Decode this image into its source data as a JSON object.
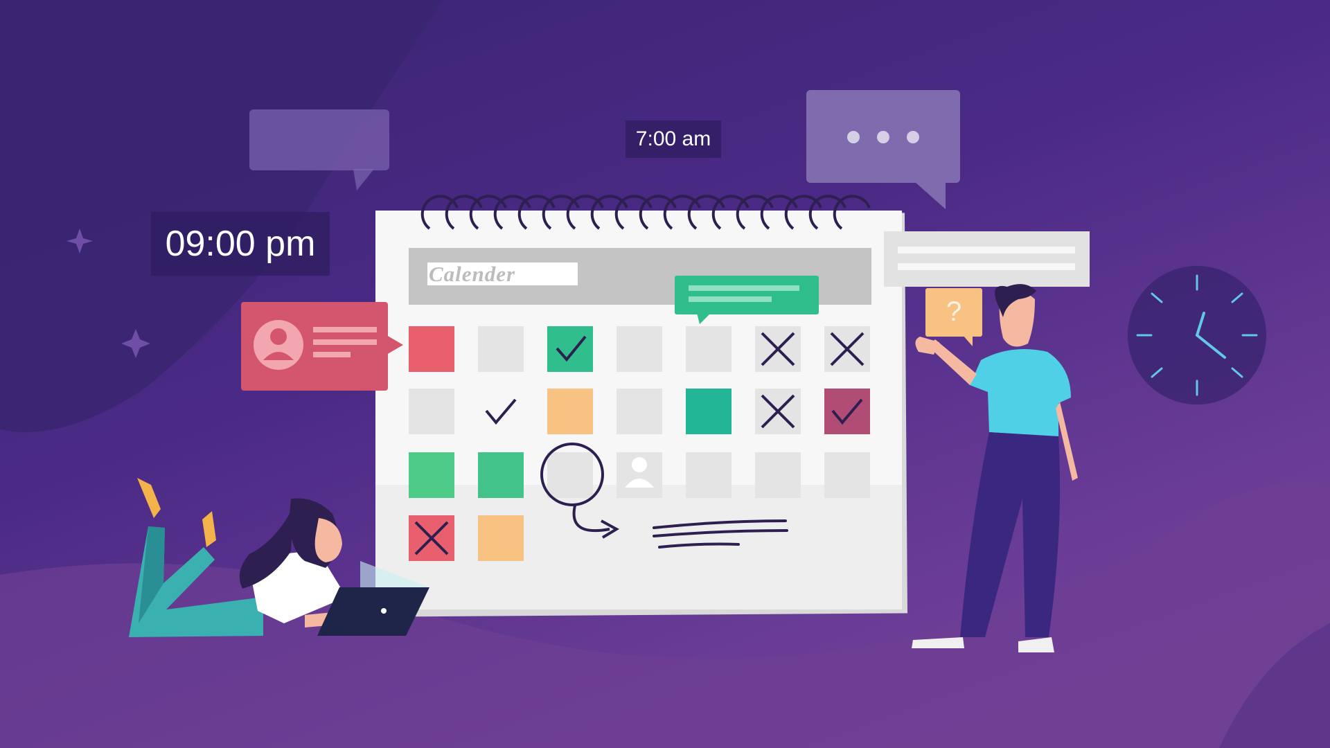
{
  "scene": {
    "time_large": "09:00 pm",
    "time_small": "7:00 am",
    "calendar_title": "Calender",
    "help_symbol": "?"
  },
  "calendar_grid": {
    "rows": [
      [
        "red",
        "empty",
        "green-check",
        "empty",
        "empty",
        "cross",
        "cross"
      ],
      [
        "empty",
        "check",
        "orange",
        "empty",
        "teal",
        "cross",
        "maroon-check"
      ],
      [
        "green",
        "green",
        "circled",
        "person",
        "empty",
        "empty",
        "empty"
      ],
      [
        "red-cross",
        "orange",
        "none",
        "none",
        "none",
        "none",
        "none"
      ]
    ]
  },
  "colors": {
    "background_top": "#3a2470",
    "background_bottom": "#7a4699",
    "red": "#e8606e",
    "green": "#4ecb86",
    "teal": "#22b696",
    "orange": "#f8c283",
    "maroon": "#b14c75",
    "cell_empty": "#e4e4e4",
    "ink": "#2d2050"
  },
  "icons": [
    "chat-bubble-icon",
    "typing-dots-icon",
    "clock-icon",
    "user-icon",
    "question-icon",
    "laptop-icon",
    "sparkle-icon"
  ]
}
